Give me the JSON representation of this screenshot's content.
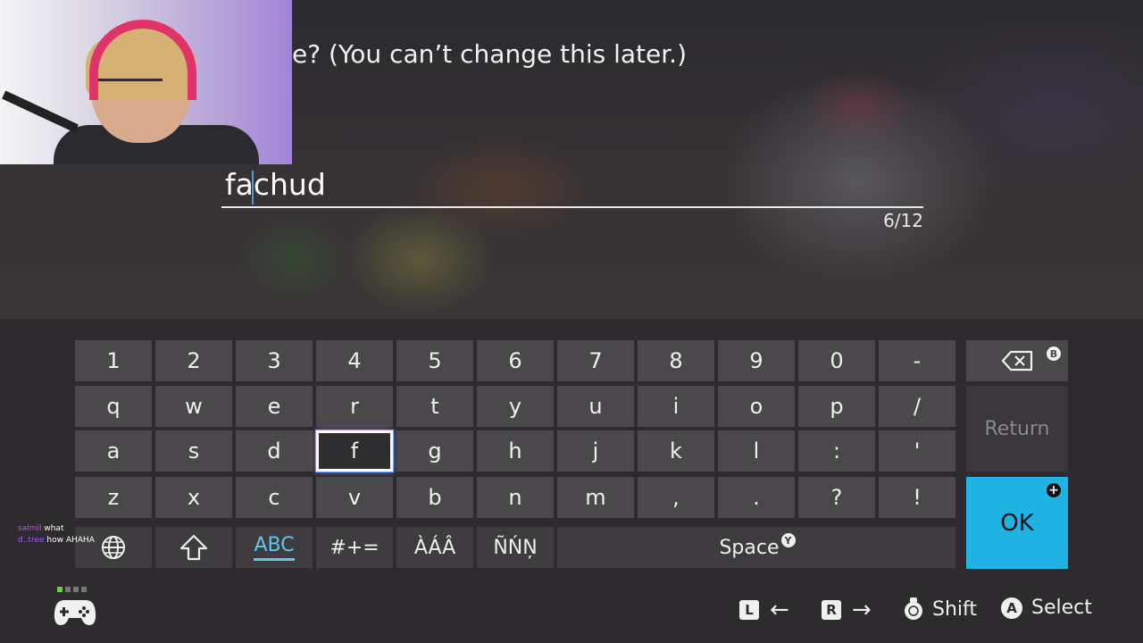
{
  "prompt": "e? (You can’t change this later.)",
  "input": {
    "value": "fachud",
    "counter": "6/12"
  },
  "keyboard": {
    "rows": [
      [
        "1",
        "2",
        "3",
        "4",
        "5",
        "6",
        "7",
        "8",
        "9",
        "0",
        "-"
      ],
      [
        "q",
        "w",
        "e",
        "r",
        "t",
        "y",
        "u",
        "i",
        "o",
        "p",
        "/"
      ],
      [
        "a",
        "s",
        "d",
        "f",
        "g",
        "h",
        "j",
        "k",
        "l",
        ":",
        "'"
      ],
      [
        "z",
        "x",
        "c",
        "v",
        "b",
        "n",
        "m",
        ",",
        ".",
        "?",
        "!"
      ]
    ],
    "selected_key": "f",
    "modes": {
      "abc": "ABC",
      "symbols": "#+=",
      "accents": "ÀÁÂ",
      "special": "ÑŃŅ"
    },
    "space": "Space",
    "space_badge": "Y",
    "backspace_badge": "B",
    "return": "Return",
    "ok": "OK",
    "ok_badge": "+"
  },
  "footer": {
    "l_button": "L",
    "r_button": "R",
    "shift_label": "Shift",
    "a_button": "A",
    "select_label": "Select"
  },
  "chat": [
    {
      "user": "salmil",
      "message": "what"
    },
    {
      "user": "d..tree",
      "message": "how AHAHA"
    }
  ],
  "colors": {
    "ok": "#1fb3e4",
    "active_mode": "#5fc8ea",
    "key": "#4a484b",
    "panel": "#2d2b2e"
  }
}
